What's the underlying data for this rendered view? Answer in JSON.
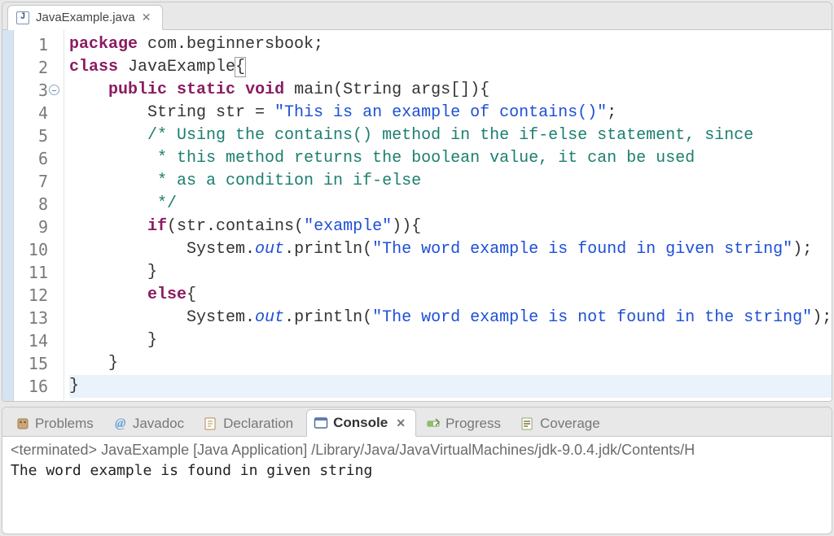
{
  "editor": {
    "tab": {
      "filename": "JavaExample.java"
    },
    "lines": [
      {
        "n": "1",
        "html": "<span class='pkw'>package</span> com.beginnersbook;"
      },
      {
        "n": "2",
        "html": "<span class='pkw'>class</span> JavaExample<span class='brkt'>{</span>"
      },
      {
        "n": "3",
        "fold": true,
        "html": "    <span class='kw'>public</span> <span class='kw'>static</span> <span class='kw'>void</span> main(String args[]){"
      },
      {
        "n": "4",
        "html": "        String str = <span class='str'>\"This is an example of contains()\"</span>;"
      },
      {
        "n": "5",
        "html": "        <span class='cmnt'>/* Using the contains() method in the if-else statement, since</span>"
      },
      {
        "n": "6",
        "html": "        <span class='cmnt'> * this method returns the boolean value, it can be used</span>"
      },
      {
        "n": "7",
        "html": "        <span class='cmnt'> * as a condition in if-else</span>"
      },
      {
        "n": "8",
        "html": "        <span class='cmnt'> */</span>"
      },
      {
        "n": "9",
        "html": "        <span class='kw'>if</span>(str.contains(<span class='str'>\"example\"</span>)){"
      },
      {
        "n": "10",
        "html": "            System.<span class='sf'>out</span>.println(<span class='str'>\"The word example is found in given string\"</span>);"
      },
      {
        "n": "11",
        "html": "        }"
      },
      {
        "n": "12",
        "html": "        <span class='kw'>else</span>{"
      },
      {
        "n": "13",
        "html": "            System.<span class='sf'>out</span>.println(<span class='str'>\"The word example is not found in the string\"</span>);"
      },
      {
        "n": "14",
        "html": "        }"
      },
      {
        "n": "15",
        "html": "    }"
      },
      {
        "n": "16",
        "hl": true,
        "html": "}"
      }
    ]
  },
  "views": {
    "tabs": [
      {
        "id": "problems",
        "label": "Problems",
        "icon": "problems-icon"
      },
      {
        "id": "javadoc",
        "label": "Javadoc",
        "icon": "javadoc-icon"
      },
      {
        "id": "declaration",
        "label": "Declaration",
        "icon": "declaration-icon"
      },
      {
        "id": "console",
        "label": "Console",
        "icon": "console-icon",
        "active": true,
        "closable": true
      },
      {
        "id": "progress",
        "label": "Progress",
        "icon": "progress-icon"
      },
      {
        "id": "coverage",
        "label": "Coverage",
        "icon": "coverage-icon"
      }
    ]
  },
  "console": {
    "terminated_line": "<terminated> JavaExample [Java Application] /Library/Java/JavaVirtualMachines/jdk-9.0.4.jdk/Contents/H",
    "output": "The word example is found in given string"
  }
}
